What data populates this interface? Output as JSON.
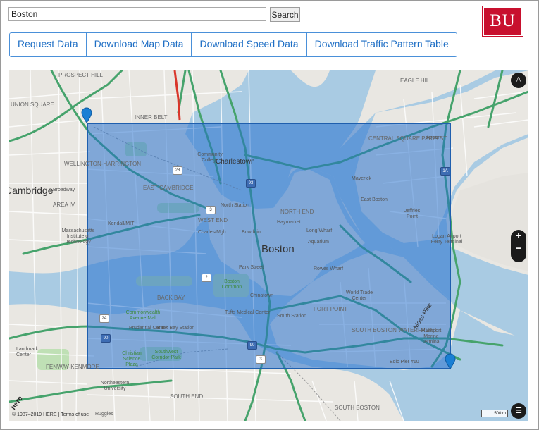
{
  "search": {
    "value": "Boston",
    "button_label": "Search"
  },
  "logo": {
    "text": "BU",
    "color": "#c8102e"
  },
  "actions": [
    {
      "label": "Request Data",
      "name": "request-data-button"
    },
    {
      "label": "Download Map Data",
      "name": "download-map-data-button"
    },
    {
      "label": "Download Speed Data",
      "name": "download-speed-data-button"
    },
    {
      "label": "Download Traffic Pattern Table",
      "name": "download-traffic-pattern-table-button"
    }
  ],
  "map": {
    "selection_color": "#2f6fc9",
    "zoom_in": "+",
    "zoom_out": "−",
    "scale_label": "500 m",
    "copyright": "© 1987–2019 HERE | Terms of use",
    "provider_logo": "here",
    "city_label": "Boston",
    "neighborhoods": [
      "PROSPECT HILL",
      "UNION SQUARE",
      "INNER BELT",
      "EAST CAMBRIDGE",
      "WELLINGTON-HARRINGTON",
      "AREA IV",
      "WEST END",
      "NORTH END",
      "BACK BAY",
      "CENTRAL SQUARE PARIS ST",
      "EAGLE HILL",
      "FORT POINT",
      "SOUTH BOSTON WATERFRONT",
      "SOUTH END",
      "FENWAY-KENMORE",
      "SOUTH BOSTON"
    ],
    "other_labels": [
      "Charlestown",
      "Cambridge",
      "Broadway",
      "Park Street",
      "Bowdoin",
      "Haymarket",
      "Chinatown",
      "South Station",
      "Kendall/MIT",
      "Charles/Mgh",
      "North Station",
      "Long Wharf",
      "Aquarium",
      "Rowes Wharf",
      "Tufts Medical Center",
      "Back Bay Station",
      "Prudential Center",
      "Commonwealth Avenue Mall",
      "Boston Common",
      "Community College",
      "Massachusetts Institute of Technology",
      "Logan Airport Ferry Terminal",
      "Maverick",
      "Jeffries Point",
      "East Boston",
      "World Trade Center",
      "Massport Marine Terminal",
      "Edic Pier #10",
      "Mass Pike",
      "Northeastern University",
      "Ruggles",
      "Landmark Center",
      "Christian Science Plaza",
      "Southwest Corridor Park",
      "Airport"
    ]
  }
}
